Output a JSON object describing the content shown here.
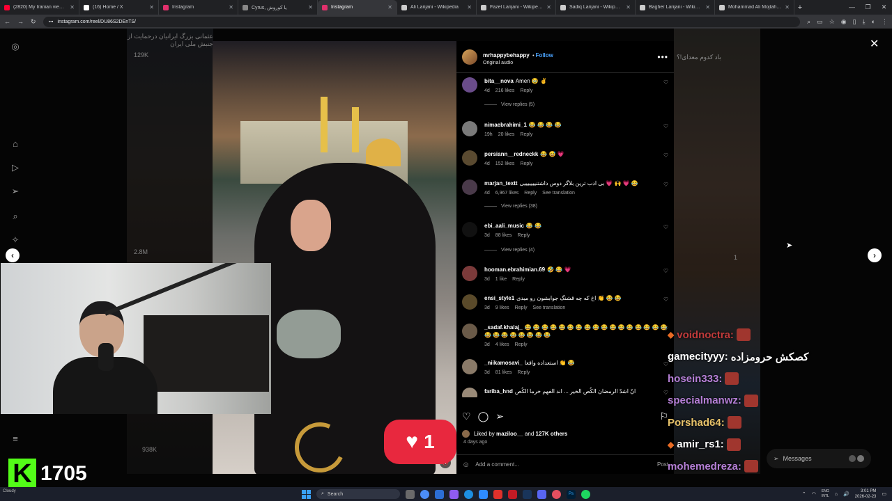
{
  "browser": {
    "tabs": [
      {
        "title": "(2820) My Iranian viewer sent",
        "color": "#ff0033",
        "active": false
      },
      {
        "title": "(16) Home / X",
        "color": "#ffffff",
        "active": false
      },
      {
        "title": "Instagram",
        "color": "#e1306c",
        "active": false
      },
      {
        "title": "Cyrus, یا کوروش",
        "color": "#888888",
        "active": false
      },
      {
        "title": "Instagram",
        "color": "#e1306c",
        "active": true
      },
      {
        "title": "Ali Larijani - Wikipedia",
        "color": "#cccccc",
        "active": false
      },
      {
        "title": "Fazel Larijani - Wikipedia",
        "color": "#cccccc",
        "active": false
      },
      {
        "title": "Sadiq Larijani - Wikipedia",
        "color": "#cccccc",
        "active": false
      },
      {
        "title": "Bagher Larijani - Wikipedia",
        "color": "#cccccc",
        "active": false
      },
      {
        "title": "Mohammad Ali Mojtahedi - ...",
        "color": "#cccccc",
        "active": false
      }
    ],
    "new_tab": "+",
    "url": "instagram.com/reel/DU86S2DEnTS/"
  },
  "background": {
    "left_caption": "عثمانی بزرگ ایرانیان درحمایت از جنبش ملی ایران",
    "left_views_top": "129K",
    "left_views_mid": "2.8M",
    "left_views_bottom": "938K",
    "right_caption": "باد کدوم معدای!؟",
    "right_views": "1"
  },
  "reel": {
    "username": "mrhappybehappy",
    "follow_label": "Follow",
    "audio": "Original audio",
    "sticker_count": "1"
  },
  "comments": [
    {
      "user": "bita__nova",
      "text": "Amen 🥹 ✌",
      "age": "4d",
      "likes": "216 likes",
      "reply": "Reply",
      "translate": "",
      "avatar": "#6a4c8a",
      "replies": "View replies (5)"
    },
    {
      "user": "nimaebrahimi_1",
      "text": "😂 😂 😂 😂",
      "age": "19h",
      "likes": "20 likes",
      "reply": "Reply",
      "translate": "",
      "avatar": "#7a7a7a",
      "replies": ""
    },
    {
      "user": "persiann__redneckk",
      "text": "😂 😅 💗",
      "age": "4d",
      "likes": "152 likes",
      "reply": "Reply",
      "translate": "",
      "avatar": "#5a4a30",
      "replies": ""
    },
    {
      "user": "marjan_textt",
      "text": "بی ادب ترین بلاگر دوس داشتنیییییییی 💗 🙌 💗 😂",
      "age": "4d",
      "likes": "6,967 likes",
      "reply": "Reply",
      "translate": "See translation",
      "avatar": "#4a3a4a",
      "replies": "View replies (38)"
    },
    {
      "user": "ebi_aali_music",
      "text": "😂 😂",
      "age": "3d",
      "likes": "88 likes",
      "reply": "Reply",
      "translate": "",
      "avatar": "#111111",
      "replies": "View replies (4)"
    },
    {
      "user": "hooman.ebrahimian.69",
      "text": "🤣 😂 💗",
      "age": "3d",
      "likes": "1 like",
      "reply": "Reply",
      "translate": "",
      "avatar": "#7b3a3a",
      "replies": ""
    },
    {
      "user": "ensi_style1",
      "text": "اخ که چه قشنگ جوابشون رو میدی 👏 😂 😂",
      "age": "3d",
      "likes": "9 likes",
      "reply": "Reply",
      "translate": "See translation",
      "avatar": "#5a4a2a",
      "replies": ""
    },
    {
      "user": "_sadaf.khalaj_",
      "text": "😂 😂 😂 😂 😂 😂 😂 😂 😂 😂 😂 😂 😂 😂 😂 😂 😂 😂 😂 😂 😂 😂 😂 😂 😂",
      "age": "3d",
      "likes": "4 likes",
      "reply": "Reply",
      "translate": "",
      "avatar": "#6a5a48",
      "replies": ""
    },
    {
      "user": "_niikamosavi_",
      "text": "استعداده واقعا 👏 😂",
      "age": "3d",
      "likes": "81 likes",
      "reply": "Reply",
      "translate": "",
      "avatar": "#8a7a68",
      "replies": ""
    },
    {
      "user": "fariba_hnd",
      "text": "انّ اشدّ الرمضان الکُص الخیر ... اند الفهم خرما الکُص",
      "age": "",
      "likes": "",
      "reply": "",
      "translate": "",
      "avatar": "#9a8a78",
      "replies": ""
    }
  ],
  "post": {
    "liked_by_user": "maziloo__",
    "liked_by_and": "and",
    "liked_by_others": "127K others",
    "liked_by_prefix": "Liked by",
    "posted_ago": "4 days ago",
    "add_comment_placeholder": "Add a comment...",
    "post_label": "Post"
  },
  "stream": {
    "kick_logo": "K",
    "followers": "1705",
    "chat": [
      {
        "user": "voidnoctra:",
        "color": "#c03a3a",
        "msg": "",
        "badge": "◆"
      },
      {
        "user": "gamecityyy:",
        "color": "#ffffff",
        "msg": "کصکش حرومزاده",
        "badge": ""
      },
      {
        "user": "hosein333:",
        "color": "#b57fd6",
        "msg": "",
        "badge": ""
      },
      {
        "user": "specialmanwz:",
        "color": "#b57fd6",
        "msg": "",
        "badge": ""
      },
      {
        "user": "Porshad64:",
        "color": "#e8c36a",
        "msg": "",
        "badge": ""
      },
      {
        "user": "amir_rs1:",
        "color": "#ffffff",
        "msg": "",
        "badge": "◆"
      },
      {
        "user": "mohemedreza:",
        "color": "#b57fd6",
        "msg": "",
        "badge": ""
      }
    ],
    "messages_label": "Messages"
  },
  "taskbar": {
    "search_label": "Search",
    "lang_top": "ENG",
    "lang_bottom": "INTL",
    "time": "3:01 PM",
    "date": "2026-02-23",
    "weather": "Cloudy"
  },
  "colors": {
    "accent": "#4aa3ff",
    "like_red": "#e8283e",
    "kick_green": "#53fc18"
  }
}
